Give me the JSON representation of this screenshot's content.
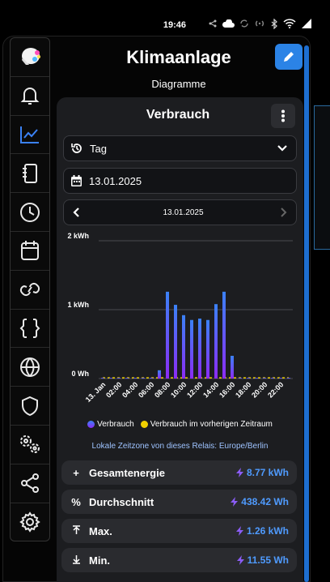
{
  "status": {
    "time": "19:46"
  },
  "header": {
    "title": "Klimaanlage",
    "subtitle": "Diagramme"
  },
  "card": {
    "title": "Verbrauch",
    "period": "Tag",
    "date": "13.01.2025",
    "nav_date": "13.01.2025",
    "timezone": "Lokale Zeitzone von dieses Relais: Europe/Berlin"
  },
  "legend": {
    "current": "Verbrauch",
    "previous": "Verbrauch im vorherigen Zeitraum"
  },
  "colors": {
    "accent": "#2b83e6",
    "bar_top": "#3b82f6",
    "bar_bottom": "#8b2cf5",
    "previous": "#f0d000"
  },
  "stats": [
    {
      "label": "Gesamtenergie",
      "value": "8.77 kWh",
      "symbol": "+"
    },
    {
      "label": "Durchschnitt",
      "value": "438.42 Wh",
      "symbol": "%"
    },
    {
      "label": "Max.",
      "value": "1.26 kWh",
      "symbol": "max"
    },
    {
      "label": "Min.",
      "value": "11.55 Wh",
      "symbol": "min"
    }
  ],
  "chart_data": {
    "type": "bar",
    "y_ticks": [
      "2 kWh",
      "1 kWh",
      "0 Wh"
    ],
    "ylim": [
      0,
      2
    ],
    "x_tick_labels": [
      "13. Jan",
      "02:00",
      "04:00",
      "06:00",
      "08:00",
      "10:00",
      "12:00",
      "14:00",
      "16:00",
      "18:00",
      "20:00",
      "22:00"
    ],
    "categories": [
      "00:00",
      "01:00",
      "02:00",
      "03:00",
      "04:00",
      "05:00",
      "06:00",
      "07:00",
      "08:00",
      "09:00",
      "10:00",
      "11:00",
      "12:00",
      "13:00",
      "14:00",
      "15:00",
      "16:00",
      "17:00",
      "18:00",
      "19:00",
      "20:00",
      "21:00",
      "22:00",
      "23:00"
    ],
    "series": [
      {
        "name": "Verbrauch",
        "values": [
          0.01,
          0.01,
          0.01,
          0.01,
          0.01,
          0.01,
          0.01,
          0.12,
          1.26,
          1.07,
          0.92,
          0.85,
          0.87,
          0.85,
          1.08,
          1.26,
          0.33,
          0.01,
          0.01,
          0.01,
          0.01,
          0.01,
          0.01,
          0.01
        ]
      },
      {
        "name": "Verbrauch im vorherigen Zeitraum",
        "values": [
          0.01,
          0.01,
          0.01,
          0.01,
          0.01,
          0.01,
          0.01,
          0.01,
          0.01,
          0.01,
          0.01,
          0.01,
          0.01,
          0.01,
          0.01,
          0.01,
          0.01,
          0.01,
          0.01,
          0.01,
          0.01,
          0.01,
          0.01,
          0.01
        ]
      }
    ],
    "grid": true
  }
}
